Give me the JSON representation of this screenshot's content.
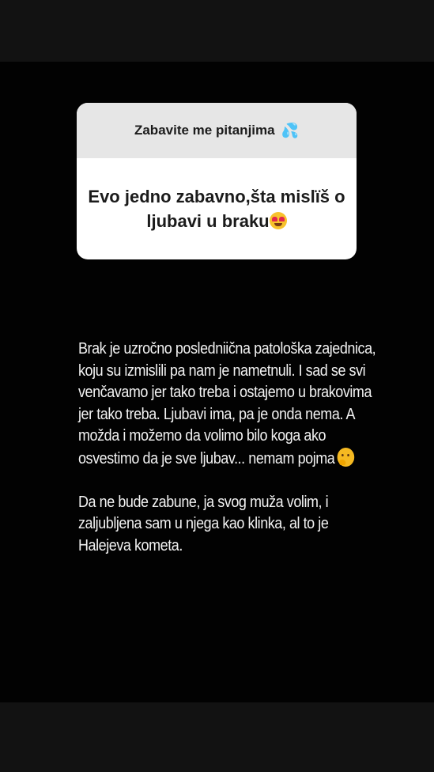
{
  "question_card": {
    "title": "Zabavite me pitanjima",
    "title_emoji": "💦",
    "question": "Evo jedno zabavno,šta mislïš o ljubavi u braku",
    "question_emoji": "heart-eyes-emoji"
  },
  "answer": {
    "paragraph_1": "Brak je uzročno posledniična patološka zajednica, koju su izmislili pa nam je nametnuli. I sad se svi venčavamo jer tako treba i ostajemo u brakovima jer tako treba. Ljubavi ima, pa je onda nema. A možda i možemo da volimo bilo koga ako osvestimo da je sve ljubav... nemam pojma",
    "paragraph_1_emoji": "thinking-face-emoji",
    "paragraph_2": "Da ne bude zabune, ja svog muža volim, i zaljubljena sam u njega kao klinka, al to je Halejeva kometa."
  },
  "colors": {
    "background": "#121212",
    "story_background": "#020202",
    "card_header": "#e6e6e6",
    "card_body": "#ffffff",
    "answer_text": "#f2f2f2"
  }
}
